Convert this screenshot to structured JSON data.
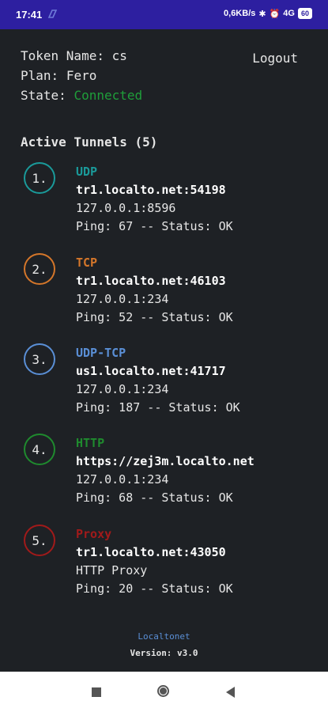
{
  "status_bar": {
    "time": "17:41",
    "right_text": "0,6KB/s",
    "bluetooth": "✱",
    "alarm": "⏰",
    "signal": "4G",
    "battery": "60"
  },
  "info": {
    "token_label": "Token Name:",
    "token_value": "cs",
    "plan_label": "Plan:",
    "plan_value": "Fero",
    "state_label": "State:",
    "state_value": "Connected",
    "state_color": "#1f9e3a"
  },
  "logout_label": "Logout",
  "section_title": "Active Tunnels (5)",
  "tunnels": [
    {
      "number": "1.",
      "protocol": "UDP",
      "color": "#1a9a9a",
      "host": "tr1.localto.net:54198",
      "target": "127.0.0.1:8596",
      "status": "Ping: 67 -- Status: OK"
    },
    {
      "number": "2.",
      "protocol": "TCP",
      "color": "#d4762a",
      "host": "tr1.localto.net:46103",
      "target": "127.0.0.1:234",
      "status": "Ping: 52 -- Status: OK"
    },
    {
      "number": "3.",
      "protocol": "UDP-TCP",
      "color": "#5a8fd6",
      "host": "us1.localto.net:41717",
      "target": "127.0.0.1:234",
      "status": "Ping: 187 -- Status: OK"
    },
    {
      "number": "4.",
      "protocol": "HTTP",
      "color": "#1f8a2e",
      "host": "https://zej3m.localto.net",
      "target": "127.0.0.1:234",
      "status": "Ping: 68 -- Status: OK"
    },
    {
      "number": "5.",
      "protocol": "Proxy",
      "color": "#a11a1a",
      "host": "tr1.localto.net:43050",
      "target": "HTTP Proxy",
      "status": "Ping: 20 -- Status: OK"
    }
  ],
  "footer": {
    "brand": "Localtonet",
    "version": "Version: v3.0"
  }
}
